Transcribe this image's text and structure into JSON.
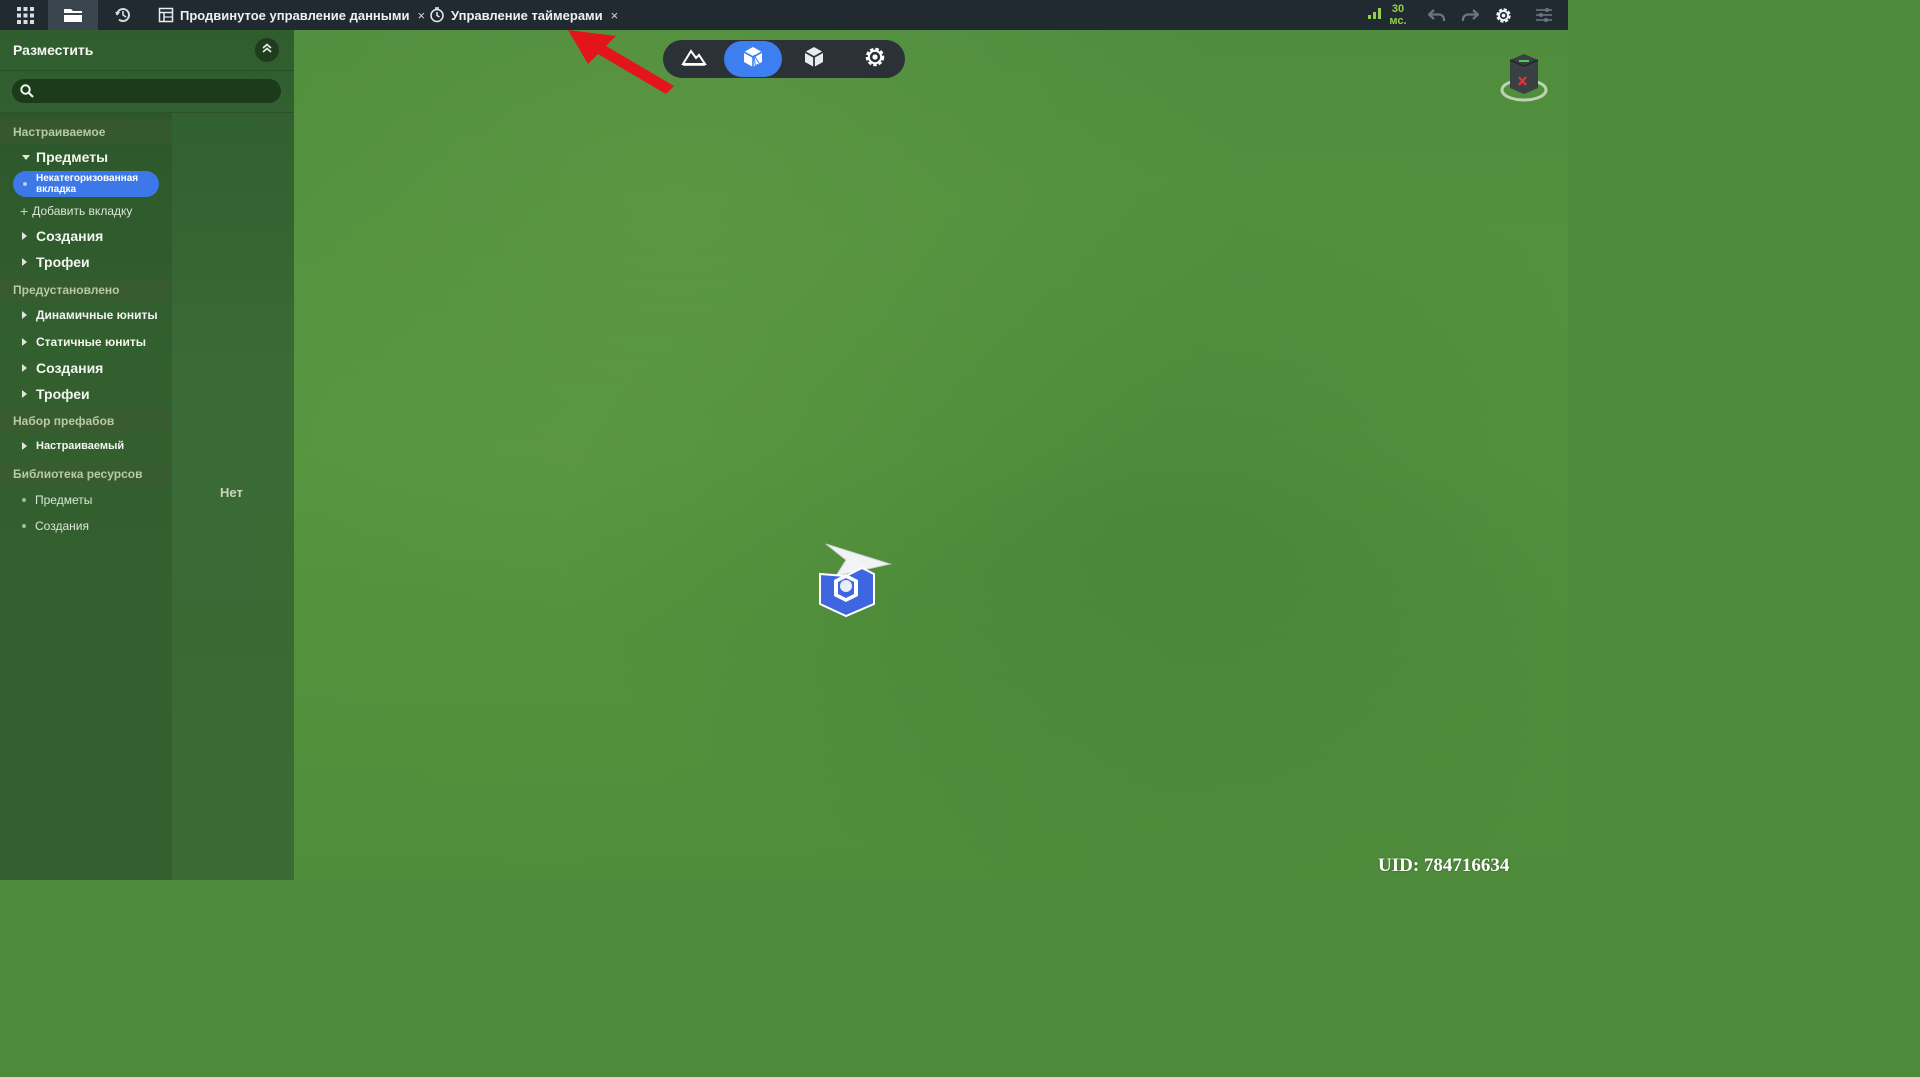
{
  "topbar": {
    "tabs": [
      {
        "label": "Продвинутое управление данными",
        "icon": "table-icon",
        "close": "×"
      },
      {
        "label": "Управление таймерами",
        "icon": "timer-icon",
        "close": "×"
      }
    ],
    "ping_value": "30",
    "ping_unit": "мс.",
    "icons": [
      "apps-grid-icon",
      "folder-icon",
      "history-icon",
      "signal-icon",
      "undo-icon",
      "redo-icon",
      "gear-icon",
      "sliders-icon"
    ]
  },
  "sidebar": {
    "title": "Разместить",
    "search_placeholder": "",
    "sections": {
      "custom": "Настраиваемое",
      "preset": "Предустановлено",
      "prefab": "Набор префабов",
      "library": "Библиотека ресурсов"
    },
    "custom_items": {
      "items": "Предметы",
      "uncategorized_tab": "Некатегоризованная вкладка",
      "add_tab": "Добавить вкладку",
      "creations": "Создания",
      "trophies": "Трофеи"
    },
    "preset_items": {
      "dynamic_units": "Динамичные юниты",
      "static_units": "Статичные юниты",
      "creations": "Создания",
      "trophies": "Трофеи"
    },
    "prefab_items": {
      "custom": "Настраиваемый"
    },
    "library_items": {
      "items": "Предметы",
      "creations": "Создания"
    },
    "empty_label": "Нет"
  },
  "viewport": {
    "modes": [
      "terrain-icon",
      "entity-place-icon",
      "cube-icon",
      "settings-gear-icon"
    ],
    "active_mode": "entity-place-icon",
    "uid_text": "UID: 784716634",
    "annotation_color": "#e3141a",
    "accent_color": "#3d7ef0"
  }
}
